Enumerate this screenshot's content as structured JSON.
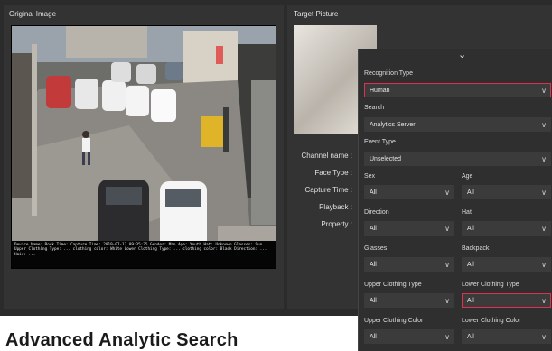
{
  "left_panel": {
    "title": "Original Image",
    "caption": "Device Name: Rock  Time: Capture Time: 2019-07-17 09:35:35 Gender: Man Age: Youth Hat: Unknown Glasses: Sun ...  Upper Clothing Type: ... clothing  color: White  Lower Clothing Type: ... clothing  color: Black  Direction: ... Hair: ..."
  },
  "right_panel": {
    "title": "Target Picture",
    "fields": [
      "Channel name :",
      "Face Type :",
      "Capture Time :",
      "Playback :",
      "Property :"
    ]
  },
  "dropdown": {
    "collapse_icon": "chevron-down-icon",
    "recognition_type": {
      "label": "Recognition Type",
      "value": "Human"
    },
    "search": {
      "label": "Search",
      "value": "Analytics Server"
    },
    "event_type": {
      "label": "Event Type",
      "value": "Unselected"
    },
    "sex": {
      "label": "Sex",
      "value": "All"
    },
    "age": {
      "label": "Age",
      "value": "All"
    },
    "direction": {
      "label": "Direction",
      "value": "All"
    },
    "hat": {
      "label": "Hat",
      "value": "All"
    },
    "glasses": {
      "label": "Glasses",
      "value": "All"
    },
    "backpack": {
      "label": "Backpack",
      "value": "All"
    },
    "upper_clothing_type": {
      "label": "Upper Clothing Type",
      "value": "All"
    },
    "lower_clothing_type": {
      "label": "Lower Clothing Type",
      "value": "All"
    },
    "upper_clothing_color": {
      "label": "Upper Clothing Color",
      "value": "All"
    },
    "lower_clothing_color": {
      "label": "Lower Clothing Color",
      "value": "All"
    }
  },
  "page_heading": "Advanced Analytic Search",
  "colors": {
    "accent": "#e03050",
    "panel": "#333333"
  }
}
